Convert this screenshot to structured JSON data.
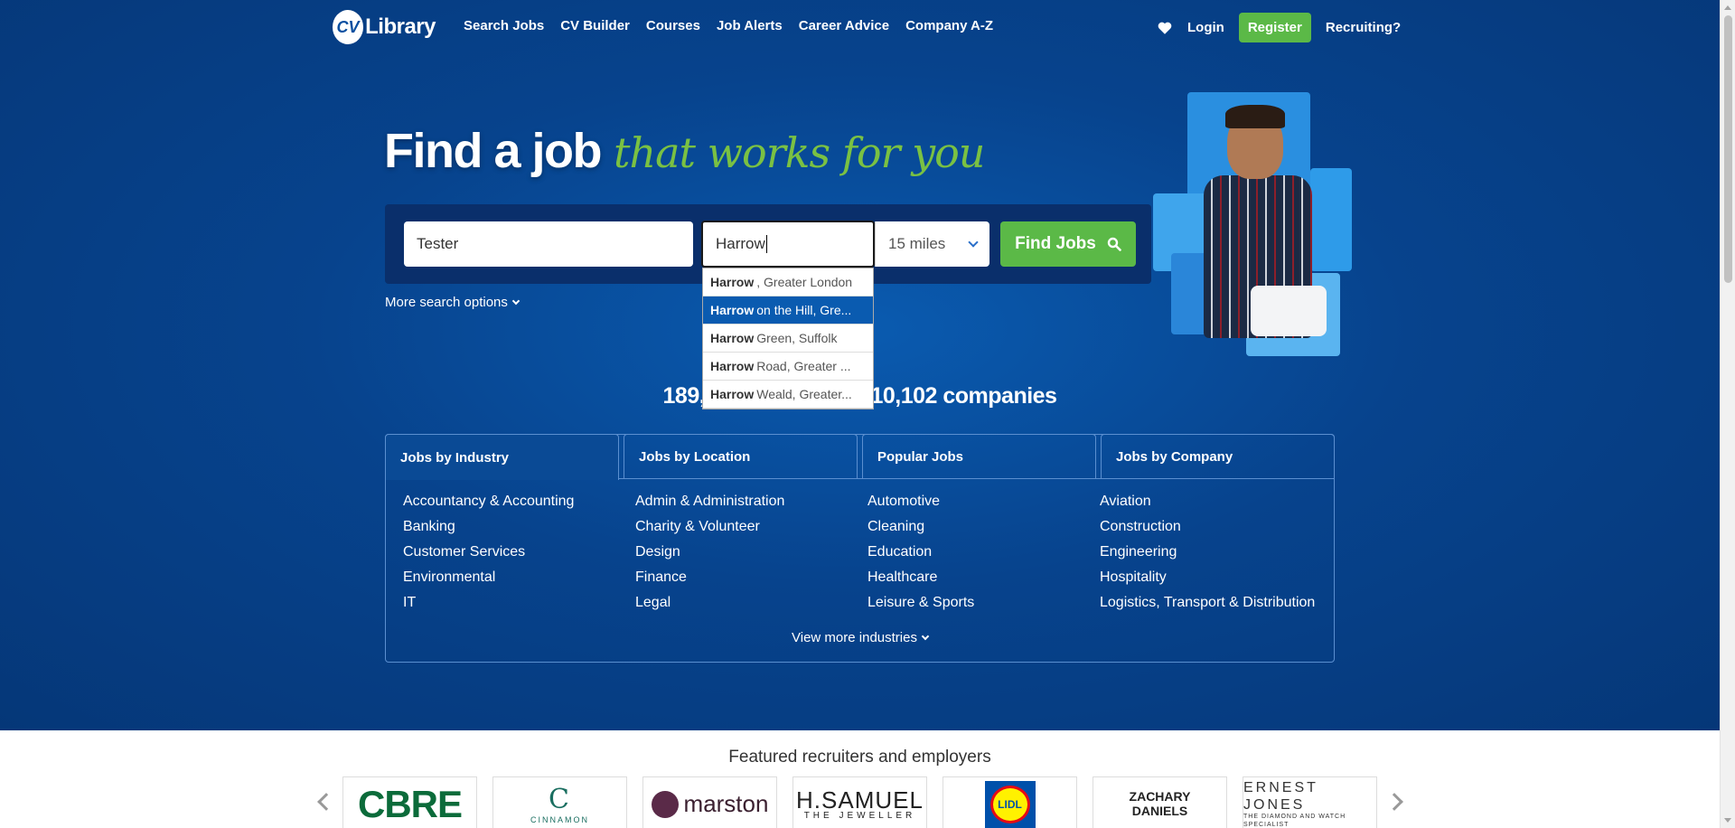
{
  "brand": {
    "logo_cv": "CV",
    "logo_text": "Library"
  },
  "nav": {
    "items": [
      "Search Jobs",
      "CV Builder",
      "Courses",
      "Job Alerts",
      "Career Advice",
      "Company A-Z"
    ],
    "login": "Login",
    "register": "Register",
    "recruiting": "Recruiting?"
  },
  "hero": {
    "title_main": "Find a job",
    "title_script": "that works for you"
  },
  "search": {
    "keywords_value": "Tester",
    "location_value": "Harrow",
    "distance_value": "15 miles",
    "find_button": "Find Jobs",
    "more_options": "More search options"
  },
  "autocomplete": {
    "selected_index": 1,
    "items": [
      {
        "bold": "Harrow",
        "rest": ", Greater London"
      },
      {
        "bold": "Harrow",
        "rest": " on the Hill, Gre..."
      },
      {
        "bold": "Harrow",
        "rest": " Green, Suffolk"
      },
      {
        "bold": "Harrow",
        "rest": " Road, Greater ..."
      },
      {
        "bold": "Harrow",
        "rest": " Weald, Greater..."
      }
    ]
  },
  "stats": {
    "text": "189,773 live jobs by 10,102 companies"
  },
  "tabs": {
    "items": [
      "Jobs by Industry",
      "Jobs by Location",
      "Popular Jobs",
      "Jobs by Company"
    ],
    "active_index": 0
  },
  "industries": [
    "Accountancy & Accounting",
    "Admin & Administration",
    "Automotive",
    "Aviation",
    "Banking",
    "Charity & Volunteer",
    "Cleaning",
    "Construction",
    "Customer Services",
    "Design",
    "Education",
    "Engineering",
    "Environmental",
    "Finance",
    "Healthcare",
    "Hospitality",
    "IT",
    "Legal",
    "Leisure & Sports",
    "Logistics, Transport & Distribution"
  ],
  "view_more": "View more industries",
  "featured": {
    "title": "Featured recruiters and employers",
    "logos": {
      "cbre": "CBRE",
      "cinnamon": "CINNAMON",
      "marston": "marston",
      "hsamuel": "H.SAMUEL",
      "hsamuel_sub": "THE JEWELLER",
      "lidl": "LIDL",
      "zachary": "ZACHARY DANIELS",
      "ernest": "ERNEST JONES",
      "ernest_sub": "THE DIAMOND AND WATCH SPECIALIST"
    }
  },
  "colors": {
    "brand_blue": "#07438d",
    "accent_green": "#5bb947",
    "selected_blue": "#0a5bb0"
  }
}
